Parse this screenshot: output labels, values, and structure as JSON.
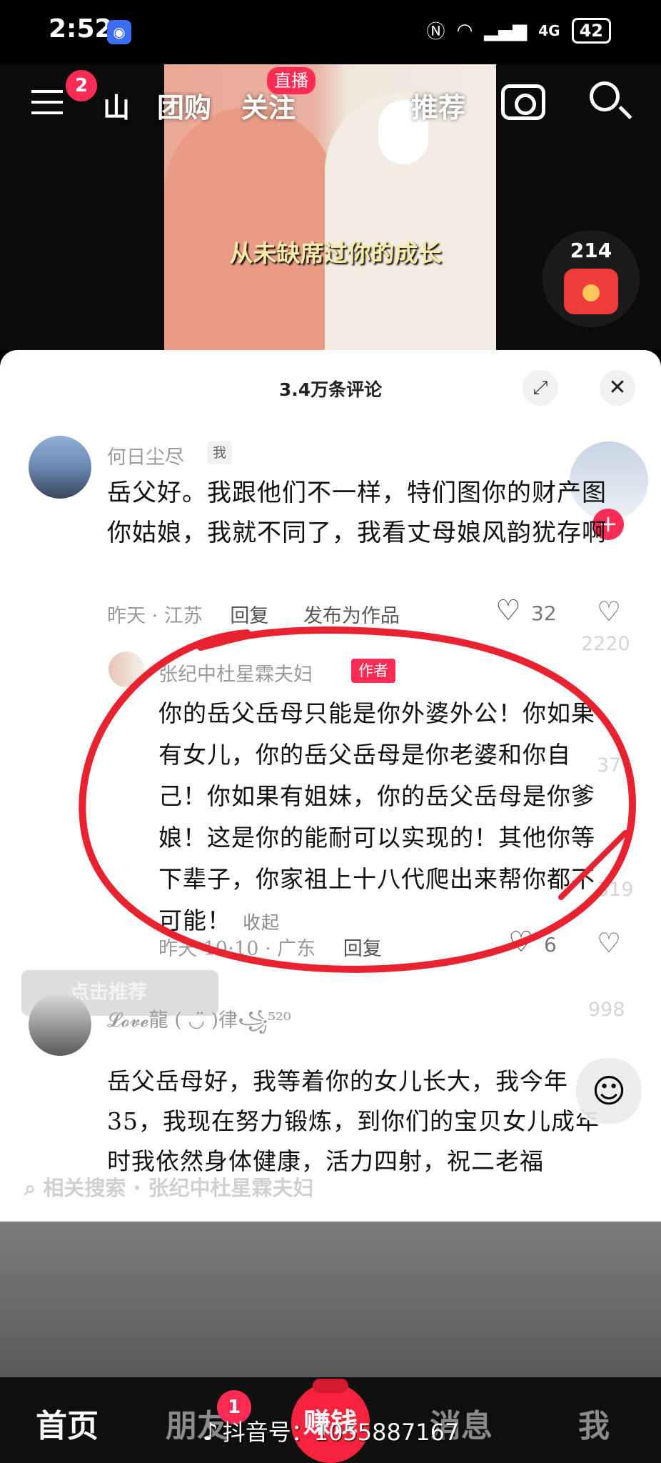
{
  "status_bar": {
    "time": "2:52",
    "network": "4G",
    "battery": "42",
    "icons": [
      "nfc-icon",
      "wifi-icon",
      "signal-icon"
    ]
  },
  "top_nav": {
    "menu_badge": "2",
    "tabs": [
      "山",
      "团购",
      "关注",
      "推荐"
    ],
    "live_badge": "直播"
  },
  "video": {
    "caption": "从未缺席过你的成长"
  },
  "red_packet": {
    "count": "214"
  },
  "comments": {
    "title": "3.4万条评论",
    "items": [
      {
        "username": "何日尘尽",
        "tag": "我",
        "text": "岳父好。我跟他们不一样，特们图你的财产图你姑娘，我就不同了，我看丈母娘风韵犹存啊",
        "time_location": "昨天 · 江苏",
        "reply": "回复",
        "publish": "发布为作品",
        "likes": "32"
      },
      {
        "username": "张纪中杜星霖夫妇",
        "tag": "作者",
        "text": "你的岳父岳母只能是你外婆外公！你如果有女儿，你的岳父岳母是你老婆和你自己！你如果有姐妹，你的岳父岳母是你爹娘！这是你的能耐可以实现的！其他你等下辈子，你家祖上十八代爬出来帮你都不可能！",
        "collapse": "收起",
        "time_location": "昨天 10:10 · 广东",
        "reply": "回复",
        "likes": "6"
      },
      {
        "username": "𝓛𝓸𝓿𝓮龍 ( ◡̈ )律꧁⁵²⁰",
        "text": "岳父岳母好，我等着你的女儿长大，我今年35，我现在努力锻炼，到你们的宝贝女儿成年时我依然身体健康，活力四射，祝二老福"
      }
    ]
  },
  "side_counters": [
    "2220",
    "371",
    "319",
    "998"
  ],
  "recommend_chip": "点击推荐",
  "related_search": "相关搜索 · 张纪中杜星霖夫妇",
  "bottom_nav": {
    "home": "首页",
    "friends": "朋友",
    "friends_badge": "1",
    "earn": "赚钱",
    "messages": "消息",
    "me": "我"
  },
  "watermark": {
    "text": "抖音号：1055887167"
  },
  "colors": {
    "brand_red": "#fe2c55",
    "annotation_red": "#e8232f"
  }
}
